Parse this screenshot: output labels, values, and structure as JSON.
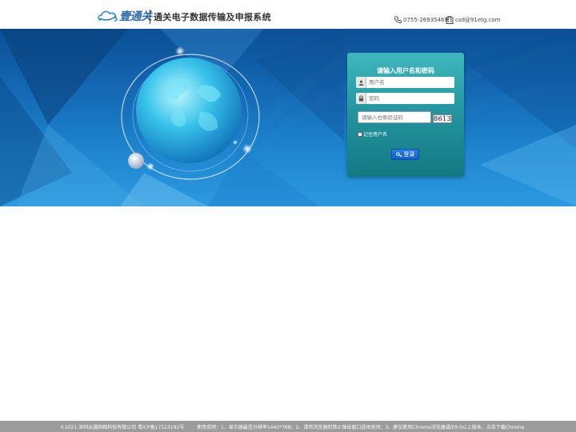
{
  "header": {
    "logo_text": "壹通关",
    "system_title": "通关电子数据传输及申报系统",
    "phone": "0755-26935469",
    "email": "csd@91etg.com",
    "phone_icon": "phone-icon",
    "email_icon": "building-icon"
  },
  "login": {
    "title": "请输入用户名和密码",
    "username_placeholder": "用户名",
    "password_placeholder": "密码",
    "captcha_placeholder": "请输入右侧验证码",
    "captcha_code": "8613",
    "remember_label": "记住用户名",
    "submit_label": "登录",
    "user_icon": "user-icon",
    "lock_icon": "lock-icon",
    "key_icon": "key-icon"
  },
  "footer": {
    "copyright": "©2021 深圳云通网络科技有限公司   粤ICP备17123192号",
    "notice": "使用说明：1、显示器最佳分辨率1440*768；2、请将浏览器的禁止弹出窗口选项关闭；3、建议使用Chrome浏览器或IE9.0以上版本，点击下载Chrome"
  },
  "colors": {
    "banner_dark": "#0b4f94",
    "banner_light": "#2b9ae0",
    "panel": "#2597a2",
    "button": "#0f5ec8",
    "footer": "#9b9b9b"
  }
}
